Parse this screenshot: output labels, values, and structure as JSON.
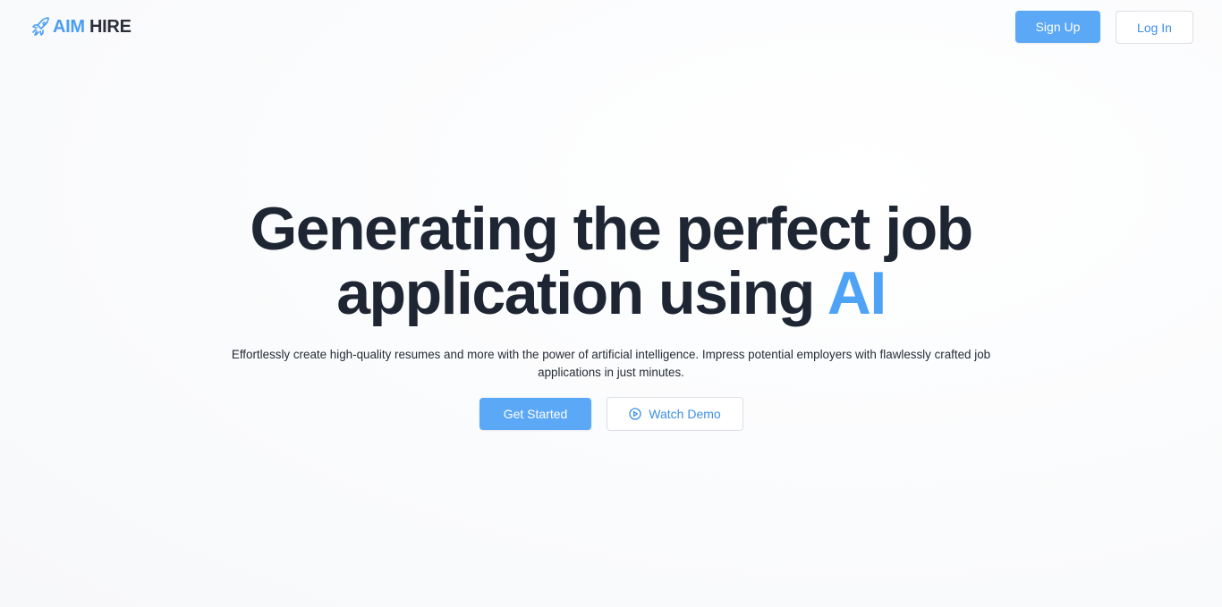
{
  "header": {
    "logo": {
      "part_ai": "AIM",
      "part_hire": " HIRE",
      "icon": "rocket-icon"
    },
    "sign_up_label": "Sign Up",
    "log_in_label": "Log In"
  },
  "hero": {
    "headline_line1": "Generating the perfect job",
    "headline_line2_prefix": "application using ",
    "headline_accent": "AI",
    "subtext": "Effortlessly create high-quality resumes and more with the power of artificial intelligence. Impress potential employers with flawlessly crafted job applications in just minutes.",
    "get_started_label": "Get Started",
    "watch_demo_label": "Watch Demo",
    "watch_demo_icon": "play-circle-icon"
  },
  "colors": {
    "accent": "#4ea3f6",
    "button_primary": "#5ba8f7",
    "heading": "#1e2533",
    "link_text": "#3d8ee8"
  }
}
